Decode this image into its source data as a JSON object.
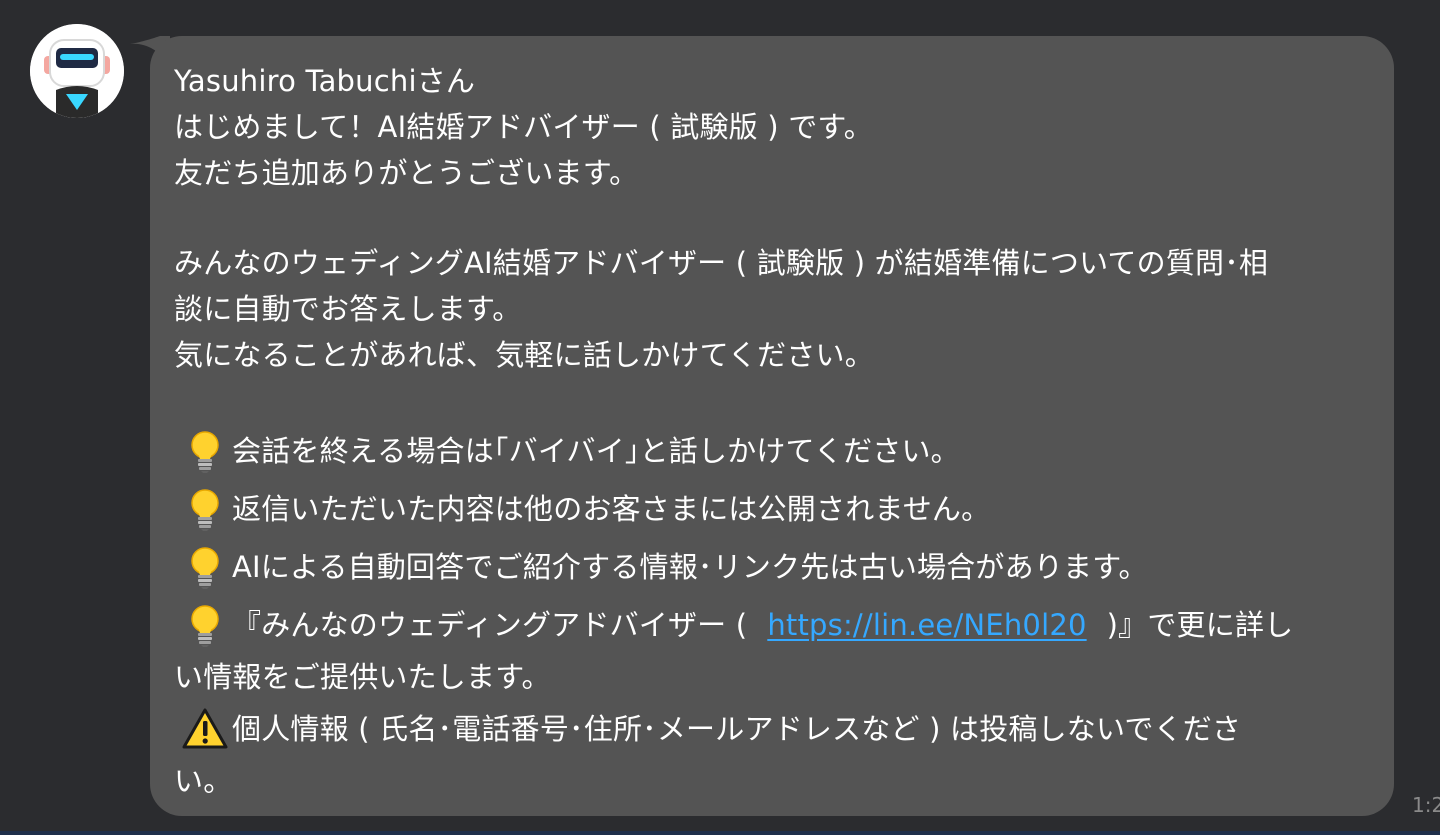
{
  "message": {
    "greeting": "Yasuhiro Tabuchiさん",
    "intro_1": "はじめまして！AI結婚アドバイザー ( 試験版 ) です。",
    "intro_2": "友だち追加ありがとうございます。",
    "desc_1": "みんなのウェディングAI結婚アドバイザー ( 試験版 ) が結婚準備についての質問･相",
    "desc_2": "談に自動でお答えします。",
    "desc_3": "気になることがあれば、気軽に話しかけてください。",
    "tip_1": "会話を終える場合は｢バイバイ｣と話しかけてください。",
    "tip_2": "返信いただいた内容は他のお客さまには公開されません。",
    "tip_3": "AIによる自動回答でご紹介する情報･リンク先は古い場合があります。",
    "tip_4_before": "『みんなのウェディングアドバイザー (",
    "tip_4_link": "https://lin.ee/NEh0l20",
    "tip_4_after": ")』で更に詳し",
    "tip_4_cont": "い情報をご提供いたします。",
    "warn_1": "個人情報 ( 氏名･電話番号･住所･メールアドレスなど ) は投稿しないでくださ",
    "warn_2": "い。"
  },
  "timestamp": "1:2",
  "icons": {
    "avatar": "robot-avatar",
    "tip": "light-bulb-icon",
    "warning": "warning-icon"
  },
  "colors": {
    "background": "#2b2c2f",
    "bubble": "#545454",
    "link": "#35a8ff"
  }
}
